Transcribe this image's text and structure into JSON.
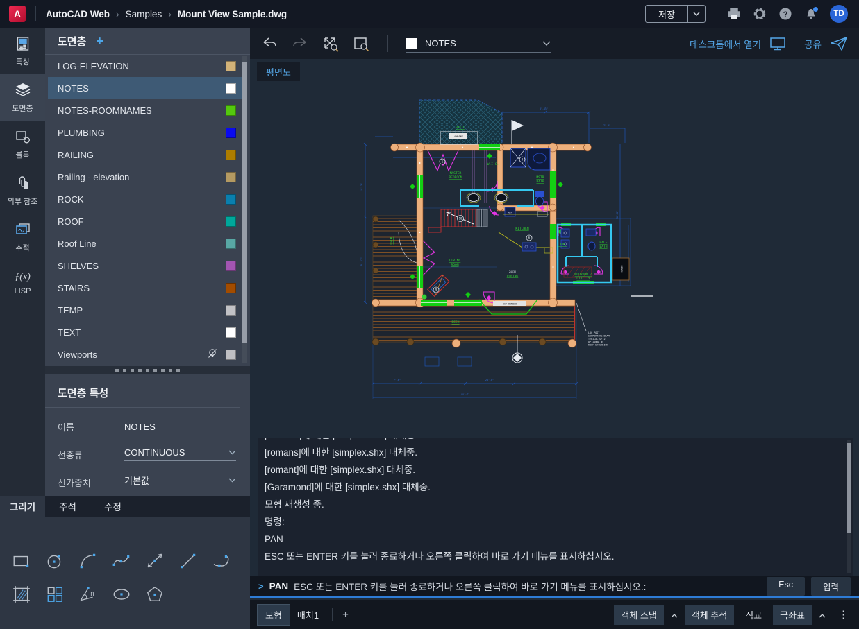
{
  "colors": {
    "accent": "#4da6e8",
    "selection": "#3e5a75",
    "command_underline": "#2e7cd6"
  },
  "header": {
    "logo": "A",
    "breadcrumb": [
      "AutoCAD Web",
      "Samples",
      "Mount View Sample.dwg"
    ],
    "save_label": "저장",
    "avatar": "TD"
  },
  "rail": {
    "items": [
      {
        "label": "특성"
      },
      {
        "label": "도면층",
        "active": true
      },
      {
        "label": "블록"
      },
      {
        "label": "외부 참조"
      },
      {
        "label": "추적"
      },
      {
        "label": "LISP"
      }
    ]
  },
  "layers_panel": {
    "title": "도면층",
    "add_label": "+",
    "items": [
      {
        "name": "LOG-ELEVATION",
        "color": "#d2b278"
      },
      {
        "name": "NOTES",
        "color": "#ffffff",
        "selected": true
      },
      {
        "name": "NOTES-ROOMNAMES",
        "color": "#54c80e"
      },
      {
        "name": "PLUMBING",
        "color": "#0a0af0"
      },
      {
        "name": "RAILING",
        "color": "#ad7d00"
      },
      {
        "name": "Railing - elevation",
        "color": "#b49a62"
      },
      {
        "name": "ROCK",
        "color": "#0a7fae"
      },
      {
        "name": "ROOF",
        "color": "#00a79b"
      },
      {
        "name": "Roof Line",
        "color": "#58a7a4"
      },
      {
        "name": "SHELVES",
        "color": "#a355b2"
      },
      {
        "name": "STAIRS",
        "color": "#a34c00"
      },
      {
        "name": "TEMP",
        "color": "#c2c2c6"
      },
      {
        "name": "TEXT",
        "color": "#ffffff"
      },
      {
        "name": "Viewports",
        "color": "#bfbfc3",
        "off": true
      }
    ]
  },
  "properties_panel": {
    "title": "도면층 특성",
    "fields": [
      {
        "label": "이름",
        "value": "NOTES"
      },
      {
        "label": "선종류",
        "value": "CONTINUOUS"
      },
      {
        "label": "선가중치",
        "value": "기본값"
      }
    ]
  },
  "tools_panel": {
    "tabs": [
      "그리기",
      "주석",
      "수정"
    ],
    "active_tab": "그리기"
  },
  "canvas": {
    "view_tab": "평면도",
    "toolbar": {
      "layer_selector": {
        "value": "NOTES",
        "swatch": "#ffffff"
      },
      "open_desktop": "데스크톱에서 열기",
      "share": "공유"
    },
    "rooms": {
      "patio": "PATIO",
      "landing": "LANDING",
      "master_bedroom": [
        "MASTER",
        "BEDROOM"
      ],
      "wic": "W.I.C.",
      "mstr_bath": [
        "MSTR",
        "BATH"
      ],
      "kitchen": "KITCHEN",
      "living_room": [
        "LIVING",
        "ROOM"
      ],
      "dining": "DINING",
      "dining_note": "24X36",
      "laundry": "LAUN.",
      "half_bath": [
        "HALF",
        "BATH"
      ],
      "mudroom": [
        "MUDROOM /",
        "UTILITY"
      ],
      "deck_left": "DECK",
      "deck_bottom": "DECK",
      "bay_window": "BAY WINDOW",
      "bench": "BENCH",
      "ref": "REF"
    },
    "annotation": [
      "LOG POST",
      "SUPPORTING BEAM,",
      "TYPICAL OF 2,",
      "OPTIONAL W/",
      "ROOF EXTENSION"
    ],
    "dims": [
      "8'-1¾\"",
      "14'-3\"",
      "9'-11\"",
      "16'-8\"",
      "7'-6\"",
      "24'-0\"",
      "11'-2\"",
      "7'-3\""
    ],
    "callouts": [
      "1",
      "10",
      "9",
      "8",
      "6"
    ]
  },
  "console": {
    "history": [
      "[romand]에 대한 [simplex.shx] 대체중.",
      "[romans]에 대한 [simplex.shx] 대체중.",
      "[romant]에 대한 [simplex.shx] 대체중.",
      "[Garamond]에 대한 [simplex.shx] 대체중.",
      "모형 재생성 중.",
      "명령:",
      "PAN",
      "ESC 또는 ENTER 키를 눌러 종료하거나 오른쪽 클릭하여 바로 가기 메뉴를 표시하십시오."
    ],
    "prompt": {
      "chevron": ">",
      "command": "PAN",
      "message": "ESC 또는 ENTER 키를 눌러 종료하거나 오른쪽 클릭하여 바로 가기 메뉴를 표시하십시오.:",
      "esc_label": "Esc",
      "enter_label": "입력"
    }
  },
  "statusbar": {
    "model_tab": "모형",
    "layout_tab": "배치1",
    "add_tab": "+",
    "toggles": [
      {
        "label": "객체 스냅",
        "active": true,
        "chevron": true
      },
      {
        "label": "객체 추적",
        "active": true
      },
      {
        "label": "직교",
        "active": false
      },
      {
        "label": "극좌표",
        "active": true,
        "chevron": true
      }
    ],
    "menu_icon": "⋮"
  }
}
